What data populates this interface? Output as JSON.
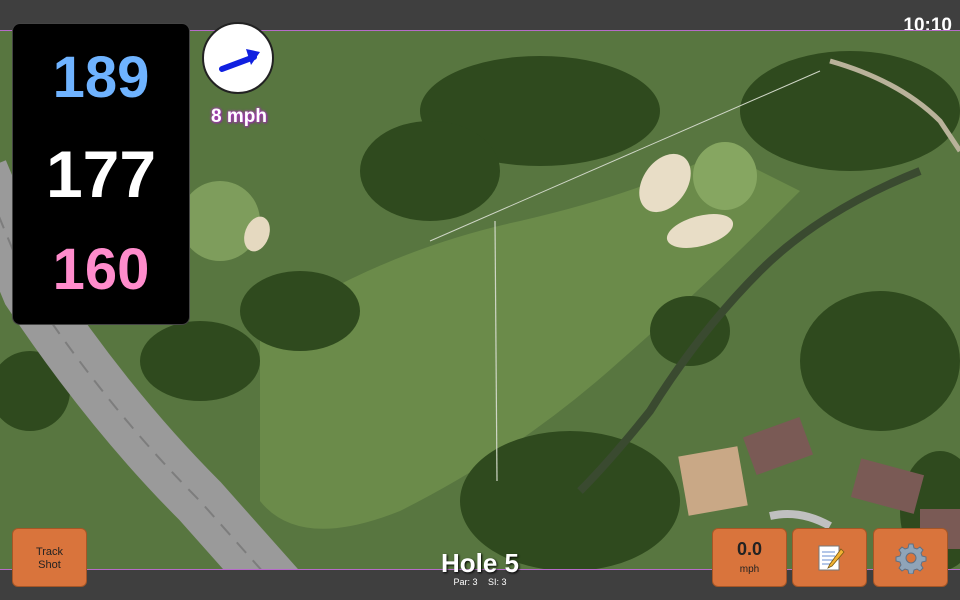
{
  "status": {
    "time": "10:10"
  },
  "distances": {
    "back": "189",
    "middle": "177",
    "front": "160"
  },
  "wind": {
    "speed_label": "8 mph",
    "icon": "wind-direction-arrow-icon"
  },
  "buttons": {
    "track_shot_label": "Track\nShot",
    "speed_value": "0.0",
    "speed_unit": "mph",
    "notes_icon": "notepad-icon",
    "settings_icon": "gear-icon"
  },
  "hole": {
    "title": "Hole 5",
    "par": "Par: 3",
    "si": "SI: 3"
  },
  "colors": {
    "back": "#6fb3ff",
    "middle": "#ffffff",
    "front": "#ff8ccc",
    "accent_button": "#d9743c",
    "wind_text_glow": "#b33cc6"
  }
}
